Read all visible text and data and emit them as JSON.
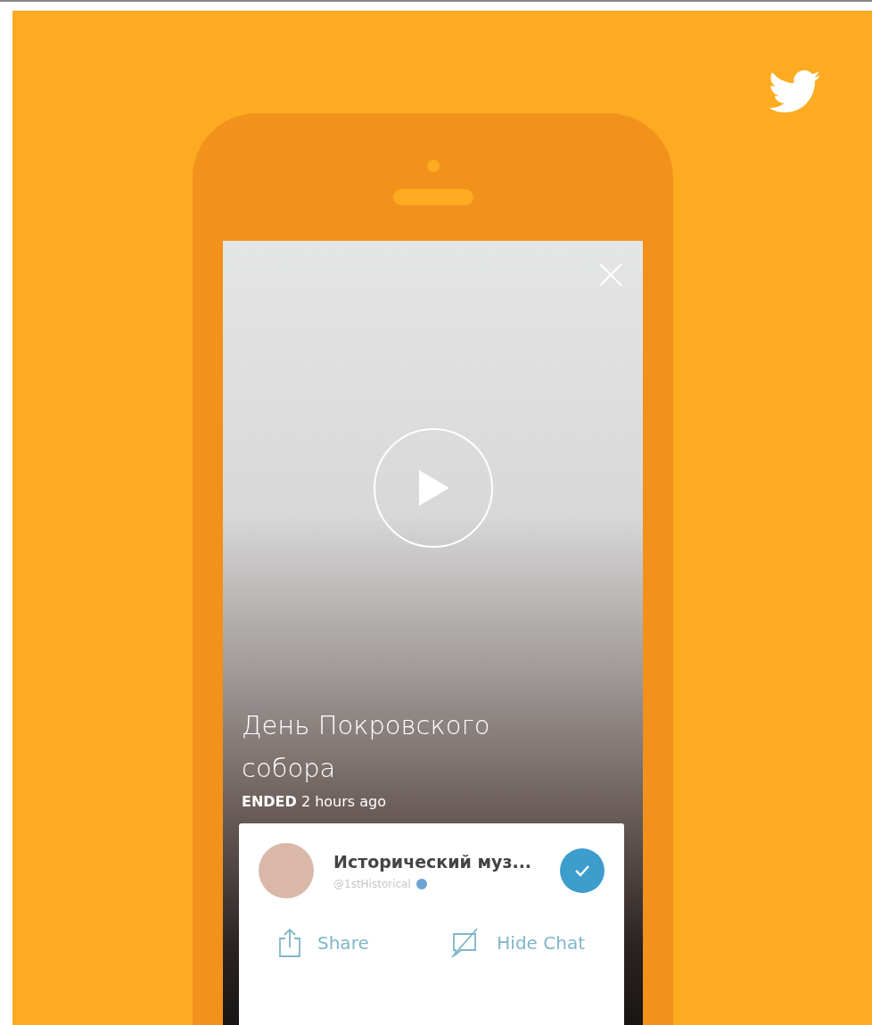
{
  "broadcast": {
    "title": "День Покровского собора",
    "status_line": "**ENDED** 2 hours ago"
  },
  "profile": {
    "name": "Исторический муз...",
    "handle": "@1stHistorical",
    "verified": true,
    "following": true
  },
  "actions": [
    {
      "label": "Share",
      "kind": "share"
    },
    {
      "label": "Hide Chat",
      "kind": "hide_chat"
    }
  ]
}
